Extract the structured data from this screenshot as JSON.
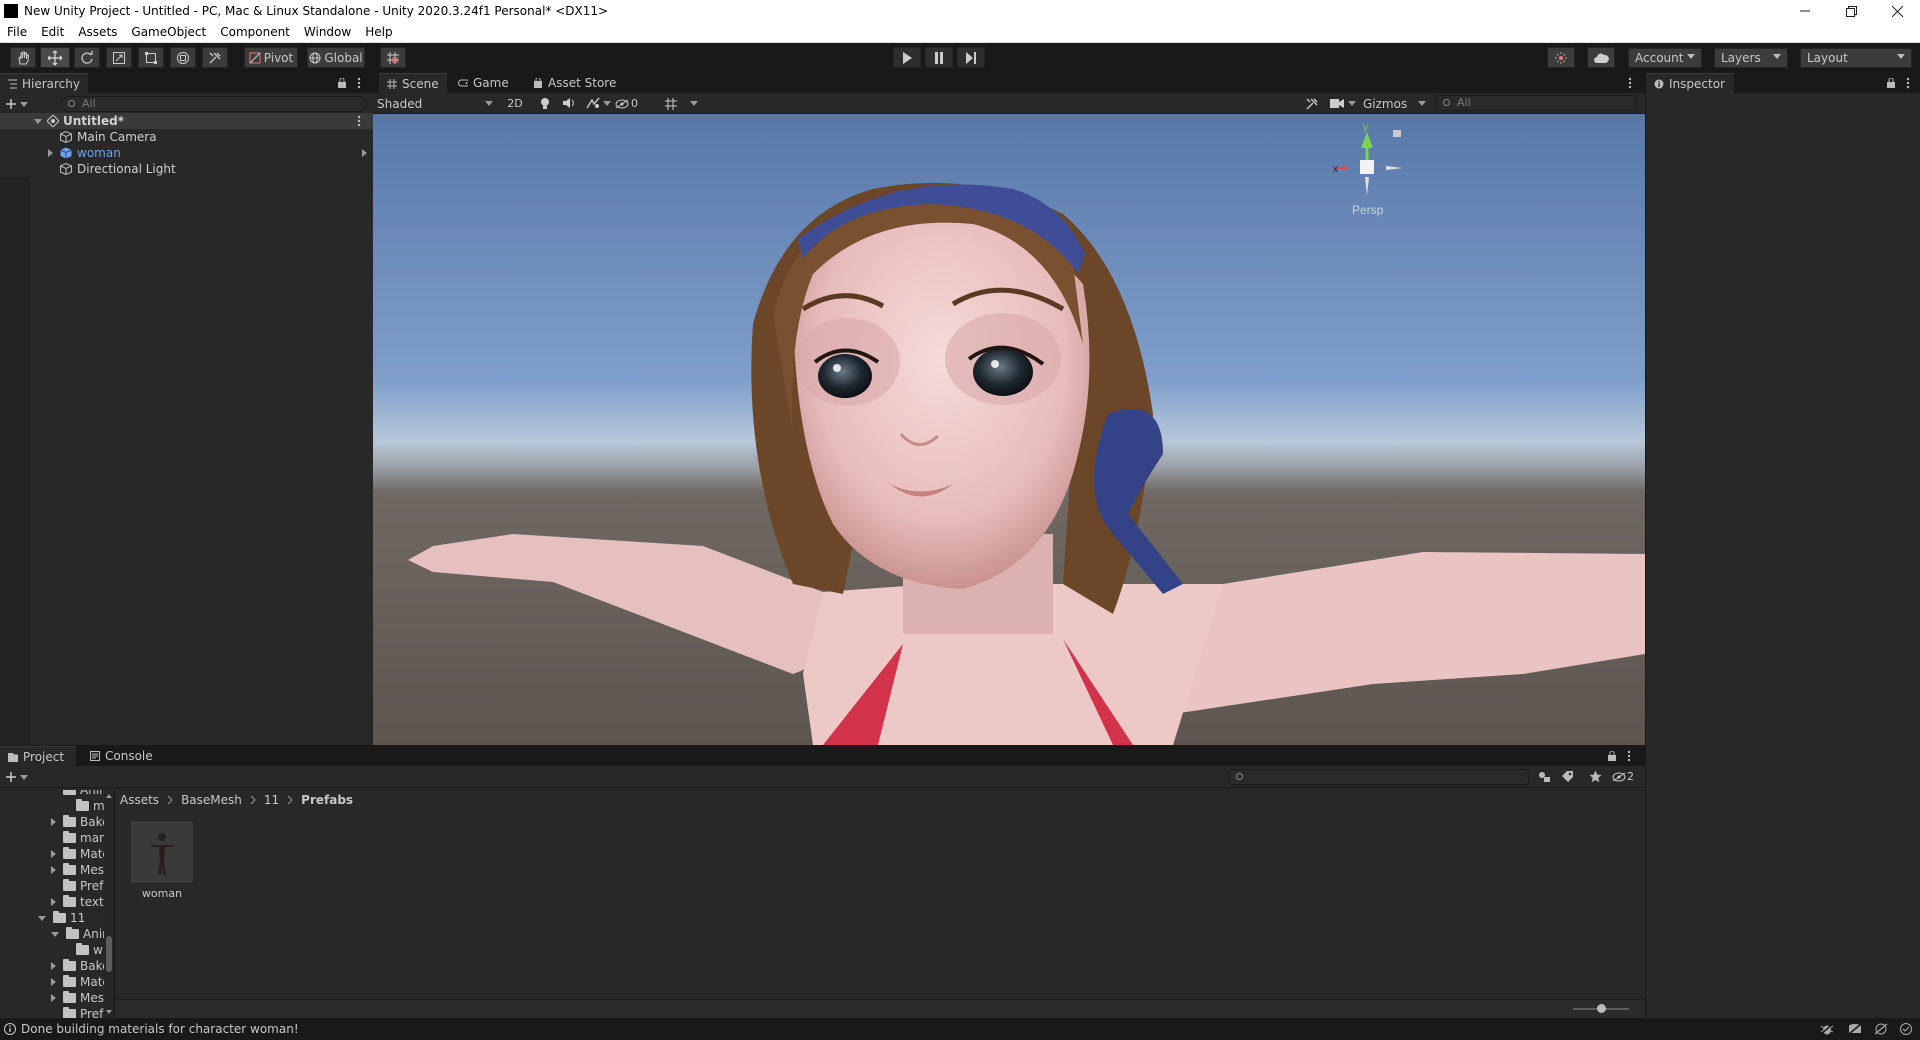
{
  "window": {
    "title": "New Unity Project - Untitled - PC, Mac & Linux Standalone - Unity 2020.3.24f1 Personal* <DX11>",
    "buttons": [
      "minimize",
      "maximize",
      "close"
    ]
  },
  "menu": [
    "File",
    "Edit",
    "Assets",
    "GameObject",
    "Component",
    "Window",
    "Help"
  ],
  "toolbar": {
    "tools": [
      "hand-tool",
      "move-tool",
      "rotate-tool",
      "scale-tool",
      "rect-tool",
      "transform-tool",
      "custom-tool"
    ],
    "active_tool": "move-tool",
    "pivot_label": "Pivot",
    "global_label": "Global",
    "account_label": "Account",
    "layers_label": "Layers",
    "layout_label": "Layout"
  },
  "hierarchy": {
    "tab_label": "Hierarchy",
    "search_placeholder": "All",
    "scene_name": "Untitled*",
    "items": [
      {
        "label": "Main Camera",
        "color": "#d0d0d0"
      },
      {
        "label": "woman",
        "color": "#6fa3ef"
      },
      {
        "label": "Directional Light",
        "color": "#d0d0d0"
      }
    ]
  },
  "scene": {
    "tabs": [
      "Scene",
      "Game",
      "Asset Store"
    ],
    "active_tab": "Scene",
    "shading_mode": "Shaded",
    "toggle_2d": "2D",
    "hidden_count": "0",
    "gizmos_label": "Gizmos",
    "search_placeholder": "All",
    "gizmo": {
      "y": "y",
      "x": "x",
      "persp": "Persp"
    }
  },
  "inspector": {
    "tab_label": "Inspector"
  },
  "project": {
    "tabs": [
      "Project",
      "Console"
    ],
    "active_tab": "Project",
    "breadcrumb": [
      "Assets",
      "BaseMesh",
      "11",
      "Prefabs"
    ],
    "hidden_count": "2",
    "tree": [
      {
        "label": "Anim",
        "indent": 3,
        "kind": "folder",
        "caret": "none"
      },
      {
        "label": "m",
        "indent": 4,
        "kind": "folder",
        "caret": "none"
      },
      {
        "label": "Bake",
        "indent": 3,
        "kind": "folder",
        "caret": "right"
      },
      {
        "label": "man",
        "indent": 3,
        "kind": "folder",
        "caret": "none"
      },
      {
        "label": "Mate",
        "indent": 3,
        "kind": "folder",
        "caret": "right"
      },
      {
        "label": "Mes",
        "indent": 3,
        "kind": "folder",
        "caret": "right"
      },
      {
        "label": "Prefa",
        "indent": 3,
        "kind": "folder",
        "caret": "none"
      },
      {
        "label": "textu",
        "indent": 3,
        "kind": "folder",
        "caret": "right"
      },
      {
        "label": "11",
        "indent": 2,
        "kind": "folder-open",
        "caret": "down"
      },
      {
        "label": "Anim",
        "indent": 3,
        "kind": "folder-open",
        "caret": "down"
      },
      {
        "label": "w",
        "indent": 4,
        "kind": "folder",
        "caret": "none"
      },
      {
        "label": "Bake",
        "indent": 3,
        "kind": "folder",
        "caret": "right"
      },
      {
        "label": "Mate",
        "indent": 3,
        "kind": "folder",
        "caret": "right"
      },
      {
        "label": "Mes",
        "indent": 3,
        "kind": "folder",
        "caret": "right"
      },
      {
        "label": "Prefa",
        "indent": 3,
        "kind": "folder",
        "caret": "none"
      }
    ],
    "assets": [
      {
        "label": "woman"
      }
    ]
  },
  "status": {
    "message": "Done building materials for character woman!"
  },
  "colors": {
    "background": "#282828",
    "dark": "#191919",
    "selected_blue": "#6fa3ef",
    "sky_top": "#5d7fae",
    "ground": "#6a625c"
  }
}
